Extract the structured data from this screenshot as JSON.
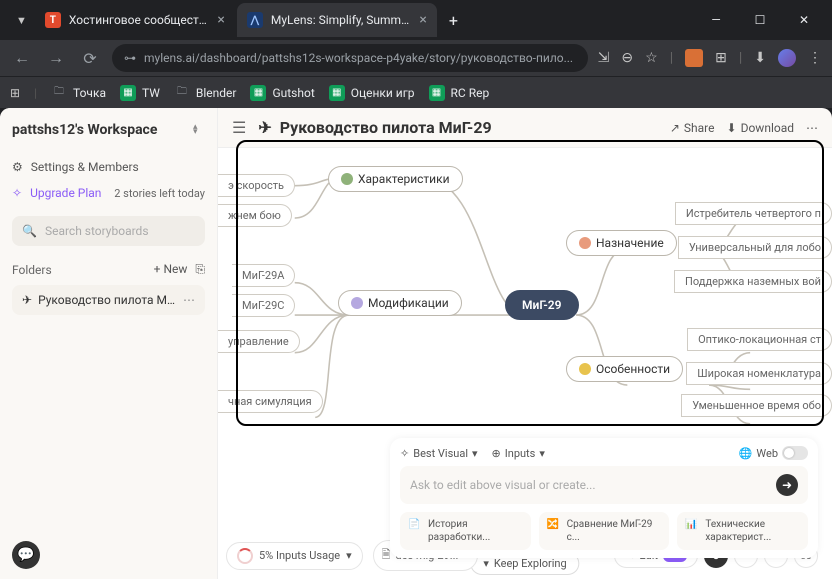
{
  "browser": {
    "tabs": [
      {
        "title": "Хостинговое сообщество «Tim",
        "favicon_bg": "#e24a2d",
        "favicon_text": "T"
      },
      {
        "title": "MyLens: Simplify, Summarize, a",
        "favicon_bg": "#1a3a6e",
        "favicon_text": "⋀"
      }
    ],
    "url": "mylens.ai/dashboard/pattshs12s-workspace-p4yake/story/руководство-пило...",
    "bookmarks": [
      {
        "label": "Точка",
        "type": "folder"
      },
      {
        "label": "TW",
        "type": "sheet"
      },
      {
        "label": "Blender",
        "type": "folder"
      },
      {
        "label": "Gutshot",
        "type": "sheet"
      },
      {
        "label": "Оценки игр",
        "type": "sheet"
      },
      {
        "label": "RC Rep",
        "type": "sheet"
      }
    ]
  },
  "sidebar": {
    "workspace": "pattshs12's Workspace",
    "settings": "Settings & Members",
    "upgrade": "Upgrade Plan",
    "stories_left": "2 stories left today",
    "search_placeholder": "Search storyboards",
    "folders_label": "Folders",
    "new_label": "+ New",
    "story": "Руководство пилота МиГ-29"
  },
  "header": {
    "title": "Руководство пилота МиГ-29",
    "share": "Share",
    "download": "Download"
  },
  "mindmap": {
    "center": "МиГ-29",
    "keep_exploring": "Keep Exploring",
    "branches_left": [
      {
        "label": "Характеристики",
        "icon": "#8fb27a",
        "leaves": [
          "э скорость",
          "жнем бою"
        ]
      },
      {
        "label": "Модификации",
        "icon": "#b5a8e0",
        "leaves": [
          "МиГ-29А",
          "МиГ-29С",
          "управление",
          "чная симуляция"
        ]
      }
    ],
    "branches_right": [
      {
        "label": "Назначение",
        "icon": "#e89b7d",
        "leaves": [
          "Истребитель четвертого п",
          "Универсальный для лобо",
          "Поддержка наземных вой"
        ]
      },
      {
        "label": "Особенности",
        "icon": "#e8c34d",
        "leaves": [
          "Оптико-локационная ст",
          "Широкая номенклатура",
          "Уменьшенное время обо"
        ]
      }
    ]
  },
  "prompt": {
    "best_visual": "Best Visual",
    "inputs": "Inputs",
    "web": "Web",
    "placeholder": "Ask to edit above visual or create...",
    "suggestions": [
      {
        "text": "История разработки..."
      },
      {
        "text": "Сравнение МиГ-29 с..."
      },
      {
        "text": "Технические характерист..."
      }
    ]
  },
  "footer": {
    "usage": "5% Inputs Usage",
    "file": "dcs mig-29...",
    "edit": "Edit"
  }
}
